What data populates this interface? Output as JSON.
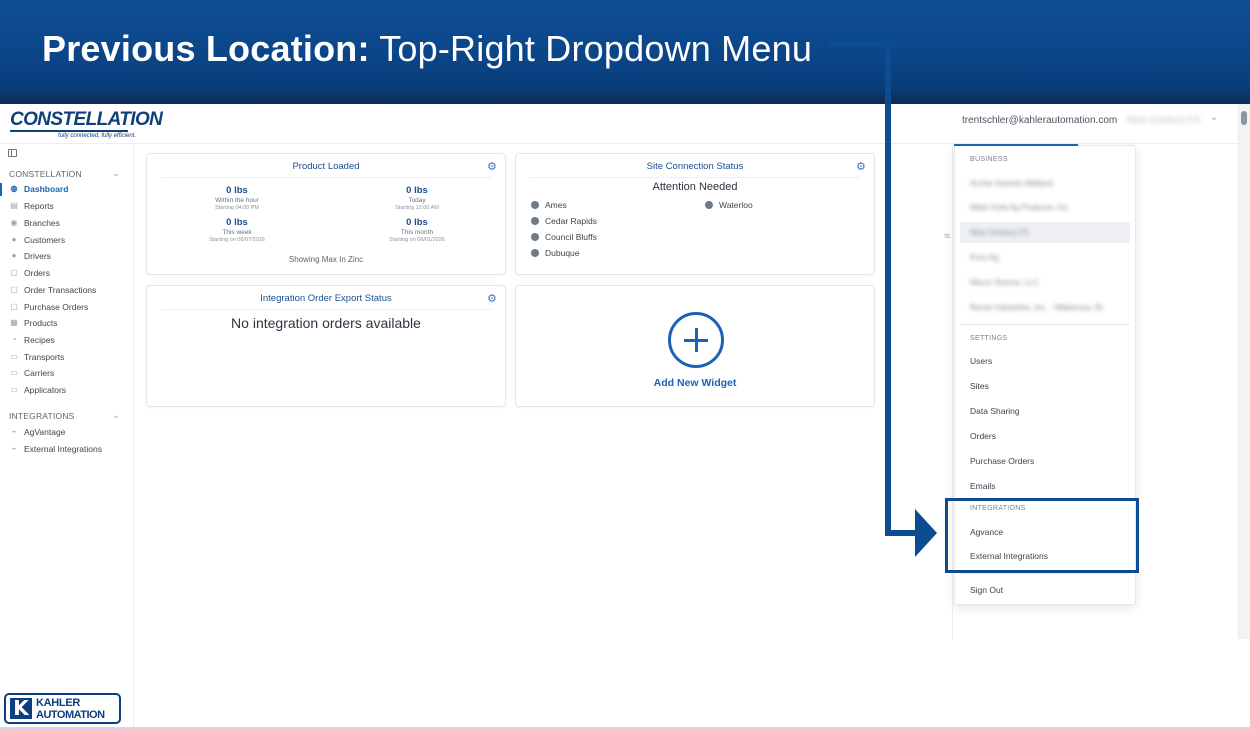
{
  "banner": {
    "title_strong": "Previous Location:",
    "title_light": "Top-Right Dropdown Menu"
  },
  "header": {
    "logo_text": "CONSTELLATION",
    "logo_tagline": "fully connected, fully efficient.",
    "user_email": "trentschler@kahlerautomation.com",
    "org_name": "New Century FS"
  },
  "sidebar": {
    "section1_label": "CONSTELLATION",
    "items": [
      {
        "label": "Dashboard",
        "icon": "dashboard-icon",
        "active": true
      },
      {
        "label": "Reports",
        "icon": "reports-icon"
      },
      {
        "label": "Branches",
        "icon": "map-pin-icon"
      },
      {
        "label": "Customers",
        "icon": "users-icon"
      },
      {
        "label": "Drivers",
        "icon": "drivers-icon"
      },
      {
        "label": "Orders",
        "icon": "orders-icon"
      },
      {
        "label": "Order Transactions",
        "icon": "transactions-icon"
      },
      {
        "label": "Purchase Orders",
        "icon": "purchase-orders-icon"
      },
      {
        "label": "Products",
        "icon": "products-icon"
      },
      {
        "label": "Recipes",
        "icon": "recipes-icon"
      },
      {
        "label": "Transports",
        "icon": "truck-icon"
      },
      {
        "label": "Carriers",
        "icon": "carriers-icon"
      },
      {
        "label": "Applicators",
        "icon": "applicator-icon"
      }
    ],
    "section2_label": "INTEGRATIONS",
    "integrations": [
      {
        "label": "AgVantage",
        "icon": "plug-icon"
      },
      {
        "label": "External Integrations",
        "icon": "plug-icon"
      }
    ]
  },
  "product_loaded": {
    "title": "Product Loaded",
    "metrics": [
      {
        "value": "0 lbs",
        "period": "Within the hour",
        "since": "Starting 04:00 PM"
      },
      {
        "value": "0 lbs",
        "period": "Today",
        "since": "Starting 12:00 AM"
      },
      {
        "value": "0 lbs",
        "period": "This week",
        "since": "Starting on 06/07/2026"
      },
      {
        "value": "0 lbs",
        "period": "This month",
        "since": "Starting on 06/01/2026"
      }
    ],
    "footnote": "Showing Max In Zinc"
  },
  "site_connection": {
    "title": "Site Connection Status",
    "subtitle": "Attention Needed",
    "sites": [
      "Ames",
      "Cedar Rapids",
      "Council Bluffs",
      "Dubuque",
      "Waterloo"
    ]
  },
  "integration_export": {
    "title": "Integration Order Export Status",
    "message": "No integration orders available"
  },
  "add_widget": {
    "label": "Add New Widget"
  },
  "hidden_peek": "St.",
  "dropdown": {
    "business_header": "BUSINESS",
    "businesses": [
      "Archer Daniels Midland",
      "Milan Kota Ag Products, Inc.",
      "New Century FS",
      "Enro Ag",
      "Macro Source, LLC",
      "Ravon Industries, Inc. - Wakarusa, IN"
    ],
    "settings_header": "SETTINGS",
    "settings": [
      "Users",
      "Sites",
      "Data Sharing",
      "Orders",
      "Purchase Orders",
      "Emails"
    ],
    "integrations_header": "INTEGRATIONS",
    "integrations": [
      "Agvance",
      "External Integrations"
    ],
    "sign_out": "Sign Out"
  },
  "footer": {
    "brand_line1": "KAHLER",
    "brand_line2": "AUTOMATION",
    "brand_mark": "K"
  },
  "colors": {
    "banner": "#0d4c91",
    "accent": "#1a62b5",
    "annotation": "#0d4c91"
  }
}
